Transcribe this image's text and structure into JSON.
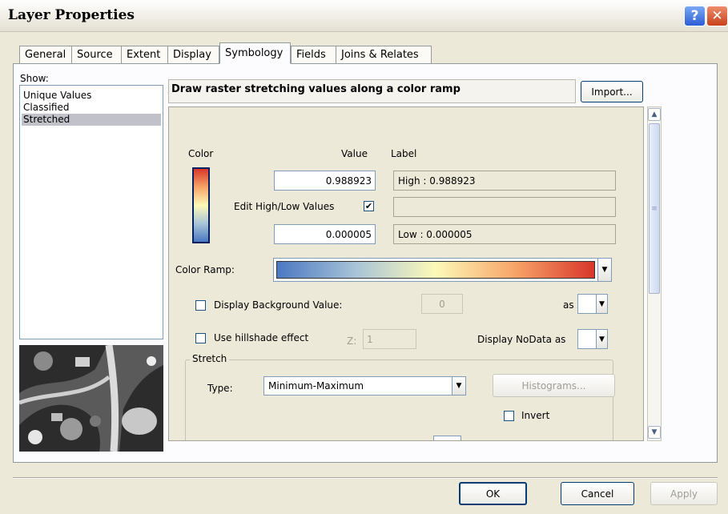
{
  "window": {
    "title": "Layer Properties"
  },
  "tabs": [
    {
      "label": "General"
    },
    {
      "label": "Source"
    },
    {
      "label": "Extent"
    },
    {
      "label": "Display"
    },
    {
      "label": "Symbology"
    },
    {
      "label": "Fields"
    },
    {
      "label": "Joins & Relates"
    }
  ],
  "active_tab": "Symbology",
  "show": {
    "label": "Show:",
    "items": [
      {
        "label": "Unique Values"
      },
      {
        "label": "Classified"
      },
      {
        "label": "Stretched"
      }
    ],
    "selected": "Stretched"
  },
  "header": {
    "title": "Draw raster stretching values along a color ramp",
    "import_label": "Import..."
  },
  "symbology": {
    "color_header": "Color",
    "value_header": "Value",
    "label_header": "Label",
    "high_value": "0.988923",
    "high_label": "High : 0.988923",
    "edit_high_low_label": "Edit High/Low Values",
    "edit_high_low_checked": "✔",
    "middle_label": "",
    "low_value": "0.000005",
    "low_label": "Low : 0.000005",
    "color_ramp_label": "Color Ramp:",
    "ramp_colors": [
      "#4a78c2",
      "#a9c4d8",
      "#fdf9b8",
      "#f7a468",
      "#d8362a"
    ],
    "display_background_label": "Display Background Value:",
    "background_value": "0",
    "as_label": "as",
    "hillshade_label": "Use hillshade effect",
    "z_label": "Z:",
    "z_value": "1",
    "nodata_label": "Display NoData as"
  },
  "stretch": {
    "group_label": "Stretch",
    "type_label": "Type:",
    "type_value": "Minimum-Maximum",
    "histograms_label": "Histograms...",
    "invert_label": "Invert"
  },
  "footer": {
    "ok": "OK",
    "cancel": "Cancel",
    "apply": "Apply"
  },
  "icons": {
    "help": "?",
    "close": "✕",
    "dropdown": "▼",
    "scroll_up": "▲",
    "scroll_down": "▼",
    "grip": "≡"
  }
}
